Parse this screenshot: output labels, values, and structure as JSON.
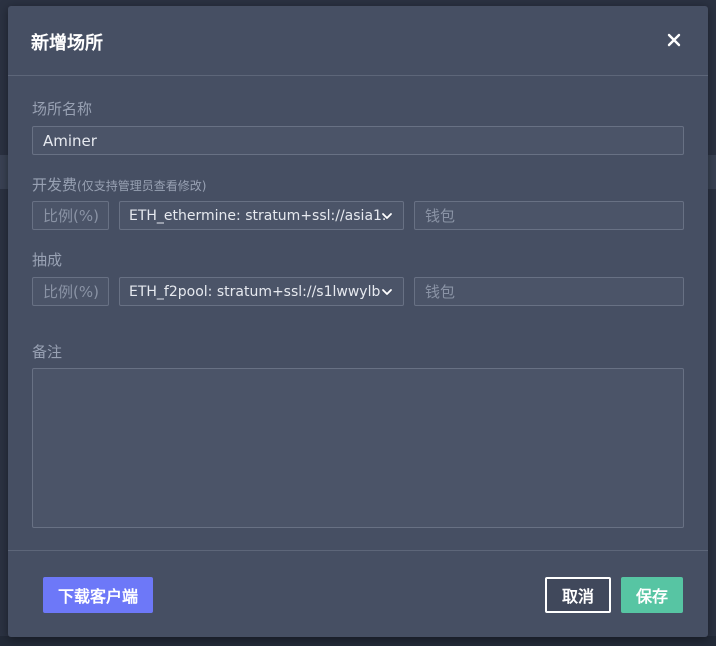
{
  "dialog": {
    "title": "新增场所",
    "close_icon": "close-icon"
  },
  "venue_name": {
    "label": "场所名称",
    "value": "Aminer"
  },
  "dev_fee": {
    "label": "开发费",
    "hint": "(仅支持管理员查看修改)",
    "ratio_placeholder": "比例(%)",
    "pool_value": "ETH_ethermine: stratum+ssl://asia1.",
    "wallet_placeholder": "钱包"
  },
  "commission": {
    "label": "抽成",
    "ratio_placeholder": "比例(%)",
    "pool_value": "ETH_f2pool: stratum+ssl://s1lwwylb",
    "wallet_placeholder": "钱包"
  },
  "remark": {
    "label": "备注",
    "value": ""
  },
  "footer": {
    "download_label": "下载客户端",
    "cancel_label": "取消",
    "save_label": "保存"
  },
  "colors": {
    "dialog_bg": "#464f63",
    "primary": "#6d78f8",
    "success": "#57c5a3"
  }
}
